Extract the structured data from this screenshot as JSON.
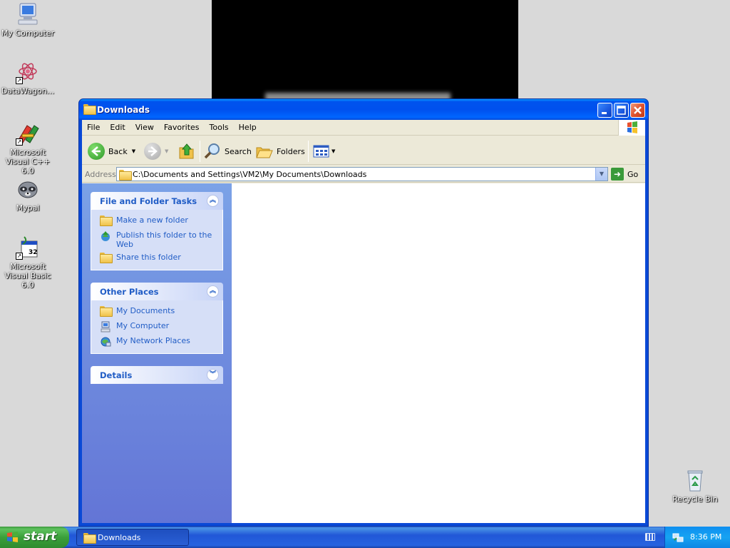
{
  "desktop": {
    "icons": [
      {
        "label": "My Computer"
      },
      {
        "label": "DataWagon..."
      },
      {
        "label": "Microsoft Visual C++ 6.0"
      },
      {
        "label": "Mypal"
      },
      {
        "label": "Microsoft Visual Basic 6.0"
      },
      {
        "label": "Recycle Bin"
      }
    ]
  },
  "window": {
    "title": "Downloads",
    "menu": [
      "File",
      "Edit",
      "View",
      "Favorites",
      "Tools",
      "Help"
    ],
    "toolbar": {
      "back": "Back",
      "search": "Search",
      "folders": "Folders"
    },
    "address": {
      "label": "Address",
      "value": "C:\\Documents and Settings\\VM2\\My Documents\\Downloads",
      "go": "Go"
    },
    "task_pane": {
      "file_folder_tasks": {
        "title": "File and Folder Tasks",
        "items": [
          "Make a new folder",
          "Publish this folder to the Web",
          "Share this folder"
        ]
      },
      "other_places": {
        "title": "Other Places",
        "items": [
          "My Documents",
          "My Computer",
          "My Network Places"
        ]
      },
      "details": {
        "title": "Details"
      }
    }
  },
  "taskbar": {
    "start": "start",
    "task_button": "Downloads",
    "clock": "8:36 PM"
  },
  "colors": {
    "title_blue": "#0053ee",
    "task_link": "#215dc6",
    "start_green": "#3a9f3a",
    "tray_blue": "#16a3f2"
  }
}
